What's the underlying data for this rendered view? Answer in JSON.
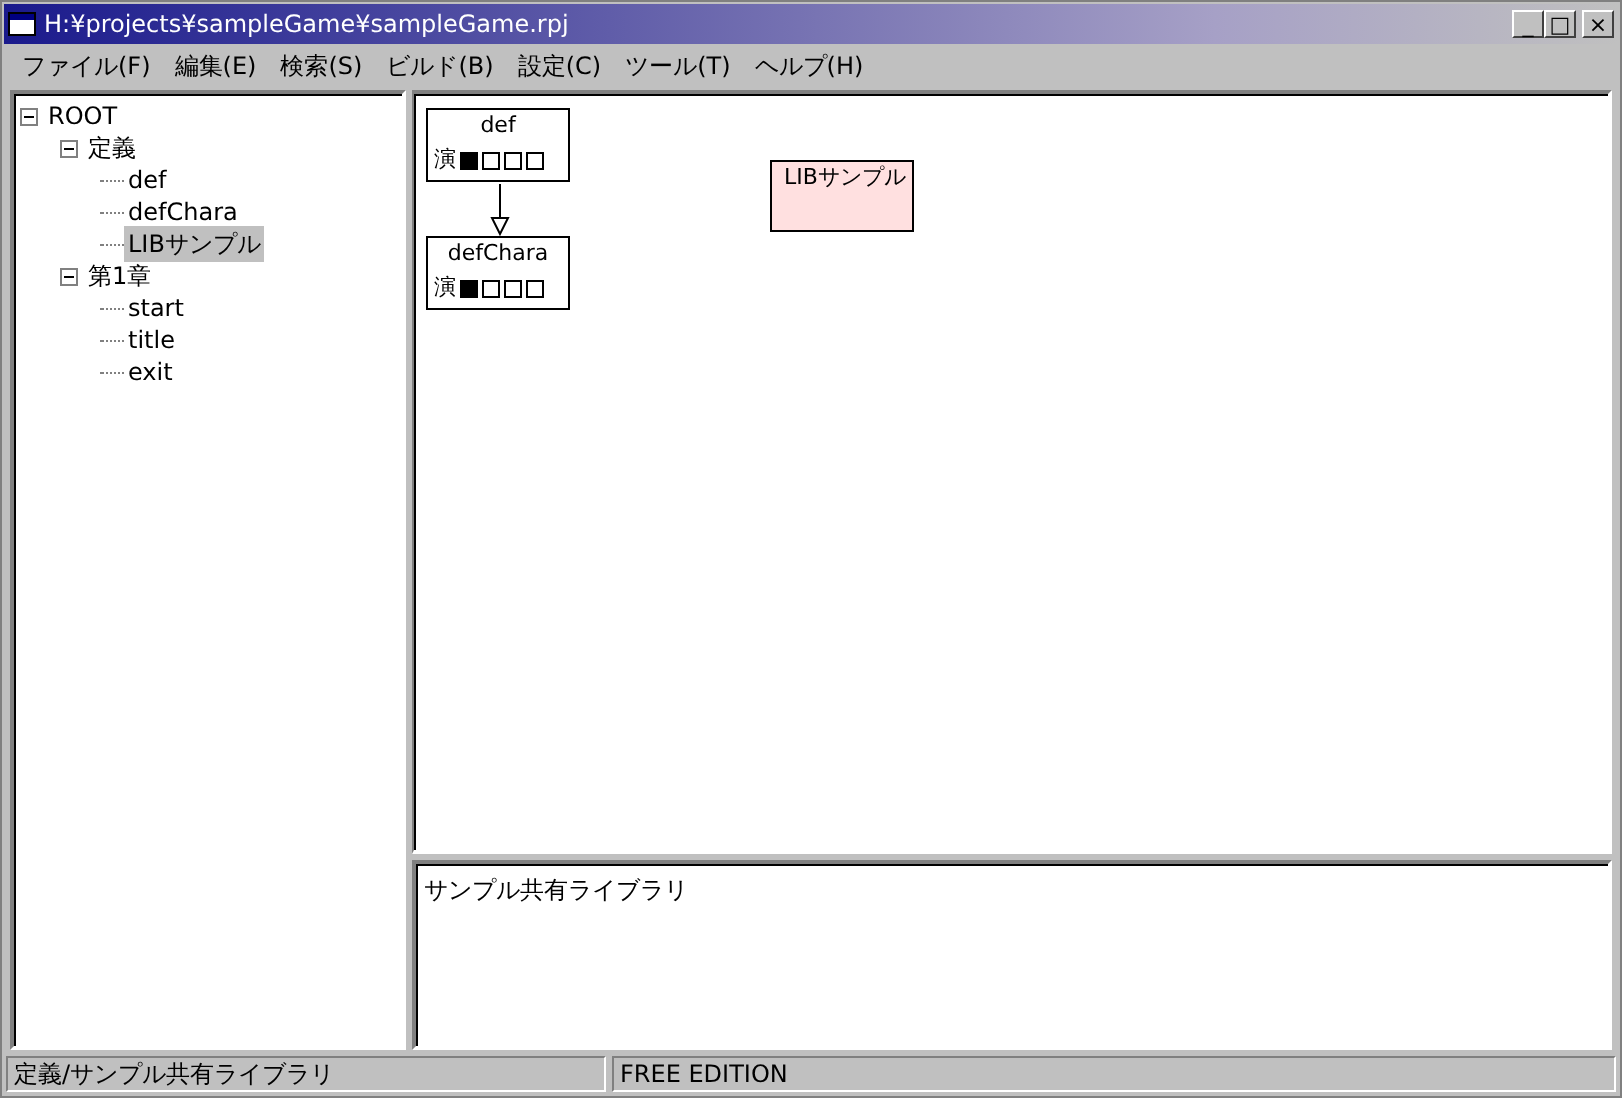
{
  "window": {
    "title": "H:¥projects¥sampleGame¥sampleGame.rpj",
    "controls": [
      "_",
      "□",
      "×"
    ]
  },
  "menu": [
    "ファイル(F)",
    "編集(E)",
    "検索(S)",
    "ビルド(B)",
    "設定(C)",
    "ツール(T)",
    "ヘルプ(H)"
  ],
  "tree": [
    {
      "label": "ROOT",
      "expanded": true,
      "selected": false,
      "children": [
        {
          "label": "定義",
          "expanded": true,
          "selected": false,
          "children": [
            {
              "label": "def",
              "selected": false
            },
            {
              "label": "defChara",
              "selected": false
            },
            {
              "label": "LIBサンプル",
              "selected": true
            }
          ]
        },
        {
          "label": "第1章",
          "expanded": true,
          "selected": false,
          "children": [
            {
              "label": "start",
              "selected": false
            },
            {
              "label": "title",
              "selected": false
            },
            {
              "label": "exit",
              "selected": false
            }
          ]
        }
      ]
    }
  ],
  "canvas": {
    "nodes": [
      {
        "kind": "scene",
        "title": "def",
        "marker": "演",
        "flags": [
          true,
          false,
          false,
          false
        ],
        "color": "#ffffff",
        "links_to_next": true
      },
      {
        "kind": "scene",
        "title": "defChara",
        "marker": "演",
        "flags": [
          true,
          false,
          false,
          false
        ],
        "color": "#ffffff"
      },
      {
        "kind": "library",
        "title": "LIBサンプル",
        "color": "#ffe0e0"
      }
    ]
  },
  "description": "サンプル共有ライブラリ",
  "status_bar": [
    "定義/サンプル共有ライブラリ",
    "FREE EDITION"
  ]
}
